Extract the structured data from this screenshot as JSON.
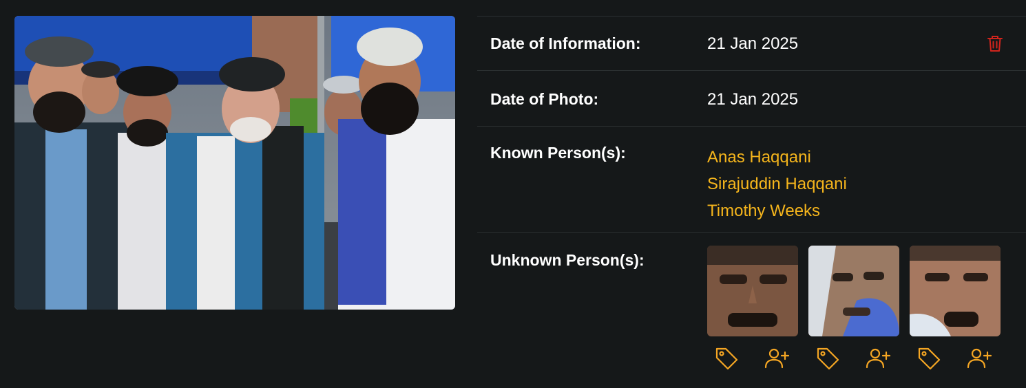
{
  "details": {
    "date_of_information_label": "Date of Information:",
    "date_of_information_value": "21 Jan 2025",
    "date_of_photo_label": "Date of Photo:",
    "date_of_photo_value": "21 Jan 2025",
    "known_persons_label": "Known Person(s):",
    "known_persons": [
      "Anas Haqqani",
      "Sirajuddin Haqqani",
      "Timothy Weeks"
    ],
    "unknown_persons_label": "Unknown Person(s):",
    "unknown_faces_count": 3
  },
  "icons": {
    "delete": "trash-icon",
    "tag": "tag-icon",
    "add_person": "user-plus-icon"
  },
  "colors": {
    "background": "#151819",
    "accent": "#f5b51c",
    "delete": "#d0241c",
    "divider": "#2b3032"
  }
}
